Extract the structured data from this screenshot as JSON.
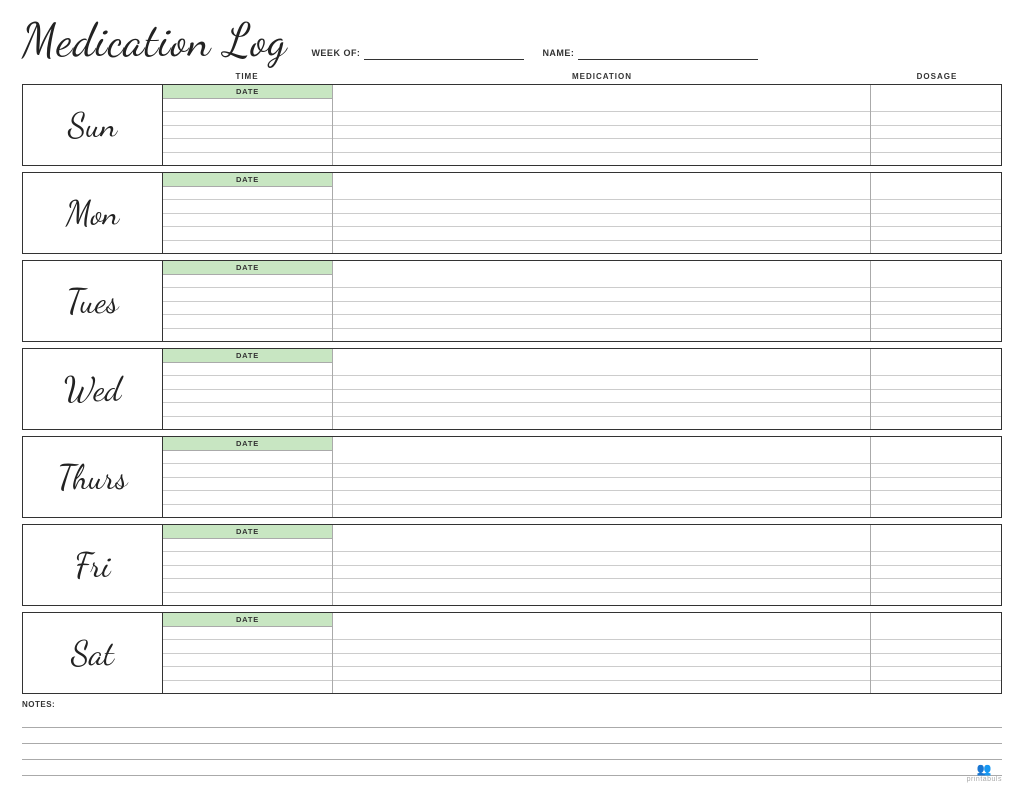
{
  "header": {
    "title": "Medication Log",
    "week_of_label": "WEEK OF:",
    "name_label": "NAME:",
    "week_of_line": "",
    "name_line": ""
  },
  "columns": {
    "time": "TIME",
    "medication": "MEDICATION",
    "dosage": "DOSAGE",
    "date_label": "DATE"
  },
  "days": [
    {
      "name": "Sun"
    },
    {
      "name": "Mon"
    },
    {
      "name": "Tues"
    },
    {
      "name": "Wed"
    },
    {
      "name": "Thurs"
    },
    {
      "name": "Fri"
    },
    {
      "name": "Sat"
    }
  ],
  "notes": {
    "label": "NOTES:"
  },
  "watermark": {
    "text": "printabuls"
  }
}
